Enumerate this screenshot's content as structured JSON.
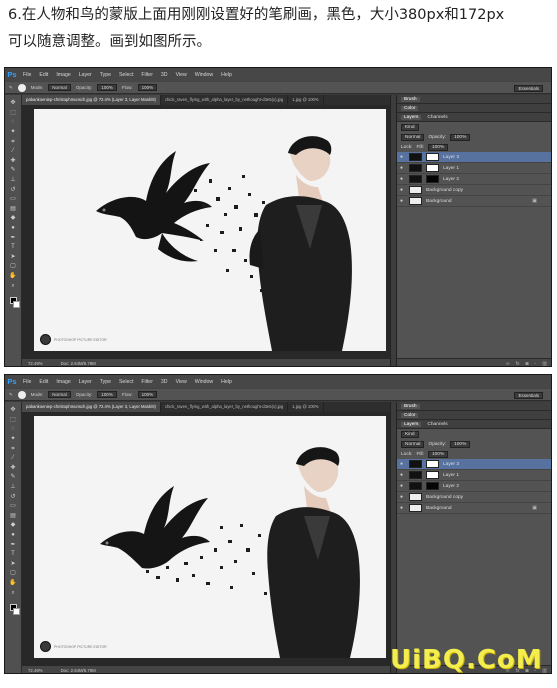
{
  "instruction": {
    "line1": "6.在人物和鸟的蒙版上面用刚刚设置好的笔刷画，黑色，大小380px和172px",
    "line2": "可以随意调整。画到如图所示。"
  },
  "app": {
    "logo": "Ps",
    "menus": [
      "File",
      "Edit",
      "Image",
      "Layer",
      "Type",
      "Select",
      "Filter",
      "3D",
      "View",
      "Window",
      "Help"
    ],
    "workspace": "Essentials"
  },
  "options_bar": {
    "mode_label": "Mode:",
    "mode_value": "Normal",
    "opacity_label": "Opacity:",
    "opacity_value": "100%",
    "flow_label": "Flow:",
    "flow_value": "100%"
  },
  "document": {
    "tabs": [
      "pabankoeniep-christophmunsch.jpg @ 72.4% (Layer 3, Layer Mask/8)",
      "chick_raven_flying_with_alpha_layer_by_nethought-d3e5(x).jpg",
      "1.jpg @ 100%"
    ],
    "zoom": "72.49%",
    "doc_size": "Doc: 2.64M/5.79M",
    "logo_text": "PHOTOSHOP PICTURE EDITOR"
  },
  "panels": {
    "top_tabs": [
      "Brush",
      "Color"
    ],
    "layer_tabs": [
      "Layers",
      "Channels"
    ],
    "kind_label": "Kind",
    "blend_mode": "Normal",
    "opacity_label": "Opacity:",
    "opacity_value": "100%",
    "lock_label": "Lock:",
    "fill_label": "Fill:",
    "fill_value": "100%",
    "layers": [
      {
        "name": "Layer 3",
        "thumb": "dark",
        "mask": "white",
        "selected": true
      },
      {
        "name": "Layer 1",
        "thumb": "dark",
        "mask": "white",
        "selected": false
      },
      {
        "name": "Layer 2",
        "thumb": "dark",
        "mask": "black",
        "selected": false
      },
      {
        "name": "Background copy",
        "thumb": "light",
        "mask": "",
        "selected": false
      },
      {
        "name": "Background",
        "thumb": "light",
        "mask": "",
        "selected": false
      }
    ]
  },
  "watermark": "UiBQ.CoM",
  "colors": {
    "ps_blue": "#30a2ff",
    "selected_layer": "#5872a0",
    "watermark": "#f4ed4e"
  }
}
